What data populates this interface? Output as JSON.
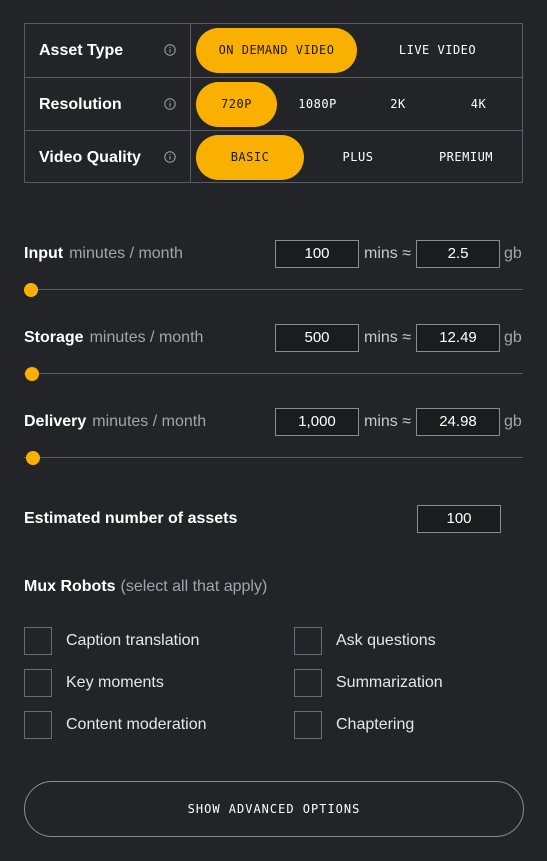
{
  "options": [
    {
      "label": "Asset Type",
      "buttons": [
        "ON DEMAND VIDEO",
        "LIVE VIDEO"
      ],
      "selected": "ON DEMAND VIDEO"
    },
    {
      "label": "Resolution",
      "buttons": [
        "720P",
        "1080P",
        "2K",
        "4K"
      ],
      "selected": "720P"
    },
    {
      "label": "Video Quality",
      "buttons": [
        "BASIC",
        "PLUS",
        "PREMIUM"
      ],
      "selected": "BASIC"
    }
  ],
  "sliders": [
    {
      "title": "Input",
      "subtitle": "minutes / month",
      "minutes": "100",
      "mins_label": "mins ≈",
      "gb": "2.5",
      "gb_label": "gb"
    },
    {
      "title": "Storage",
      "subtitle": "minutes / month",
      "minutes": "500",
      "mins_label": "mins ≈",
      "gb": "12.49",
      "gb_label": "gb"
    },
    {
      "title": "Delivery",
      "subtitle": "minutes / month",
      "minutes": "1,000",
      "mins_label": "mins ≈",
      "gb": "24.98",
      "gb_label": "gb"
    }
  ],
  "assets": {
    "label": "Estimated number of assets",
    "value": "100"
  },
  "robots": {
    "title": "Mux Robots",
    "subtitle": "(select all that apply)",
    "items": [
      "Caption translation",
      "Ask questions",
      "Key moments",
      "Summarization",
      "Content moderation",
      "Chaptering"
    ]
  },
  "advanced_label": "SHOW ADVANCED OPTIONS",
  "colors": {
    "accent": "#f9b000",
    "background": "#232427",
    "border": "#5a5c61"
  },
  "icons": {
    "info": "info-circle-icon"
  }
}
